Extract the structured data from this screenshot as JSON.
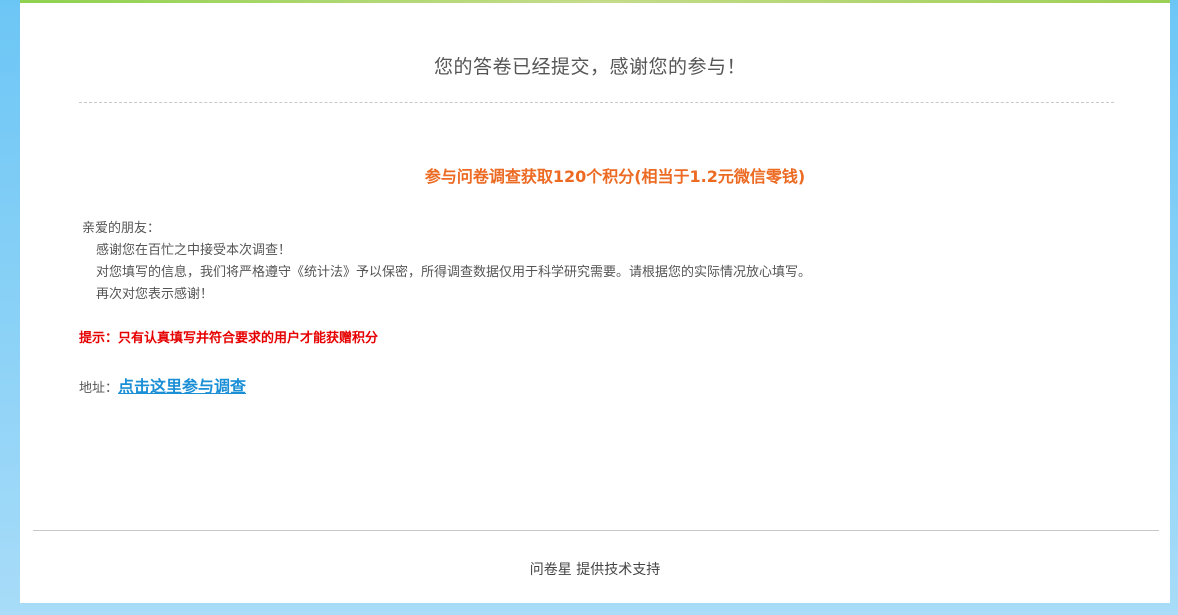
{
  "page": {
    "title": "您的答卷已经提交，感谢您的参与！",
    "promo": "参与问卷调查获取120个积分(相当于1.2元微信零钱)",
    "letter": {
      "greeting": "亲爱的朋友：",
      "lines": [
        "感谢您在百忙之中接受本次调查！",
        "对您填写的信息，我们将严格遵守《统计法》予以保密，所得调查数据仅用于科学研究需要。请根据您的实际情况放心填写。",
        "再次对您表示感谢！"
      ]
    },
    "tip": "提示：只有认真填写并符合要求的用户才能获赠积分",
    "address": {
      "label": "地址：",
      "link_text": "点击这里参与调查"
    }
  },
  "footer": {
    "brand": "问卷星",
    "support_text": "提供技术支持"
  },
  "colors": {
    "background": "#6cc6f5",
    "promo": "#ec6a22",
    "tip": "#e60000",
    "link": "#1a8fd6"
  }
}
